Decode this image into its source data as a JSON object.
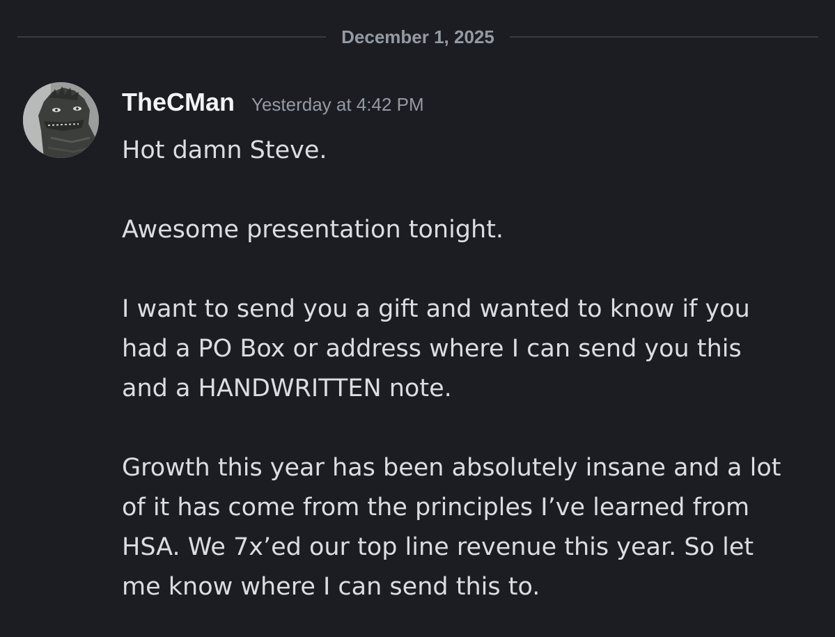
{
  "divider": {
    "date": "December 1, 2025"
  },
  "message": {
    "username": "TheCMan",
    "timestamp": "Yesterday at 4:42 PM",
    "avatar_icon": "godzilla-avatar",
    "paragraphs": [
      {
        "lines": [
          "Hot damn Steve."
        ]
      },
      {
        "lines": [
          "Awesome presentation tonight."
        ]
      },
      {
        "lines": [
          "I want to send you a gift and wanted to know if you",
          "had a PO Box or address where I can send you this",
          "and a HANDWRITTEN note."
        ]
      },
      {
        "lines": [
          "Growth this year has been absolutely insane and a lot",
          "of it has come from the principles I’ve learned from",
          "HSA. We 7x’ed our top line revenue this year. So let",
          "me know where I can send this to."
        ]
      }
    ]
  },
  "colors": {
    "background": "#1c1d22",
    "username": "#f2f3f5",
    "muted": "#949ba4",
    "text": "#dbdee1"
  }
}
